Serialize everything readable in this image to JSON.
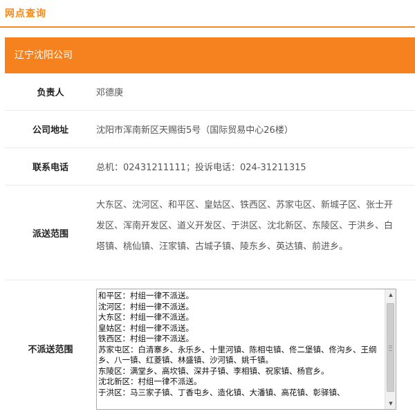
{
  "page": {
    "title": "网点查询"
  },
  "branch": {
    "name": "辽宁沈阳公司",
    "rows": {
      "leader": {
        "label": "负责人",
        "value": "邓德庚"
      },
      "address": {
        "label": "公司地址",
        "value": "沈阳市浑南新区天赐街5号（国际贸易中心26楼）"
      },
      "phone": {
        "label": "联系电话",
        "value": "总机：02431211111；投诉电话：024-31211315"
      },
      "scope": {
        "label": "派送范围",
        "value": "大东区、沈河区、和平区、皇姑区、铁西区、苏家屯区、新城子区、张士开发区、浑南开发区、道义开发区、于洪区、沈北新区、东陵区、于洪乡、白塔镇、桃仙镇、汪家镇、古城子镇、陵东乡、英达镇、前进乡。"
      },
      "no_scope": {
        "label": "不派送范围",
        "lines": [
          "和平区：村组一律不派送。",
          "沈河区：村组一律不派送。",
          "大东区：村组一律不派送。",
          "皇姑区：村组一律不派送。",
          "铁西区：村组一律不派送。",
          "苏家屯区：白清寨乡、永乐乡、十里河镇、陈相屯镇、佟二堡镇、佟沟乡、王纲乡、八一镇、红菱镇、林盛镇、沙河镇、姚千镇。",
          "东陵区：满堂乡、高坎镇、深井子镇、李相镇、祝家镇、杨官乡。",
          "沈北新区：村组一律不派送。",
          "于洪区：马三家子镇、丁香屯乡、造化镇、大潘镇、高花镇、彰驿镇、"
        ]
      }
    }
  }
}
